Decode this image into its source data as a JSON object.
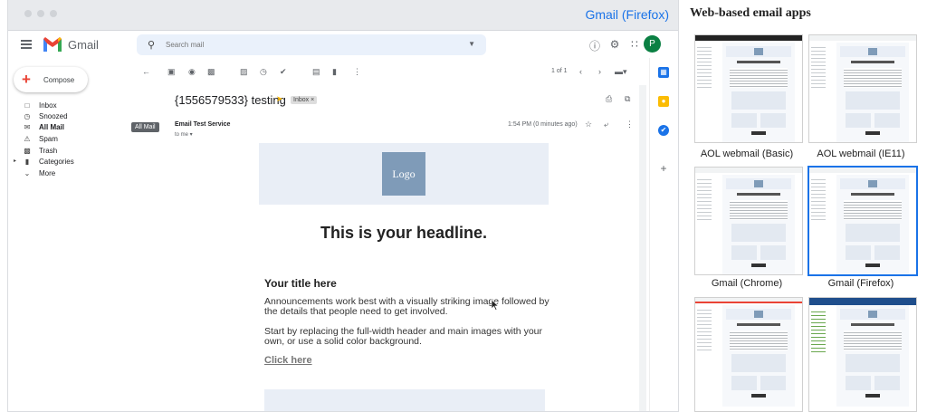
{
  "window": {
    "title": "Gmail (Firefox)"
  },
  "gmail": {
    "app_name": "Gmail",
    "search_placeholder": "Search mail",
    "avatar_initial": "P",
    "compose_label": "Compose",
    "nav": [
      {
        "label": "Inbox",
        "icon": "inbox-icon"
      },
      {
        "label": "Snoozed",
        "icon": "clock-icon"
      },
      {
        "label": "All Mail",
        "icon": "all-mail-icon",
        "active": true
      },
      {
        "label": "Spam",
        "icon": "spam-icon"
      },
      {
        "label": "Trash",
        "icon": "trash-icon"
      },
      {
        "label": "Categories",
        "icon": "label-icon"
      },
      {
        "label": "More",
        "icon": "chevron-down-icon"
      }
    ],
    "tooltip": "All Mail",
    "pager": "1 of 1",
    "message": {
      "subject": "{1556579533} testing",
      "chip": "Inbox ×",
      "sender": "Email Test Service",
      "to": "to me ▾",
      "time": "1:54 PM (0 minutes ago)"
    },
    "email": {
      "logo": "Logo",
      "headline": "This is your headline.",
      "title": "Your title here",
      "para1": "Announcements work best with a visually striking image followed by the details that people need to get involved.",
      "para2": "Start by replacing the full-width header and main images with your own, or use a solid color background.",
      "cta": "Click here"
    }
  },
  "panel": {
    "title": "Web-based email apps",
    "thumbs": [
      {
        "caption": "AOL webmail (Basic)",
        "selected": false
      },
      {
        "caption": "AOL webmail (IE11)",
        "selected": false
      },
      {
        "caption": "Gmail (Chrome)",
        "selected": false
      },
      {
        "caption": "Gmail (Firefox)",
        "selected": true
      },
      {
        "caption": "",
        "selected": false
      },
      {
        "caption": "",
        "selected": false
      }
    ]
  }
}
